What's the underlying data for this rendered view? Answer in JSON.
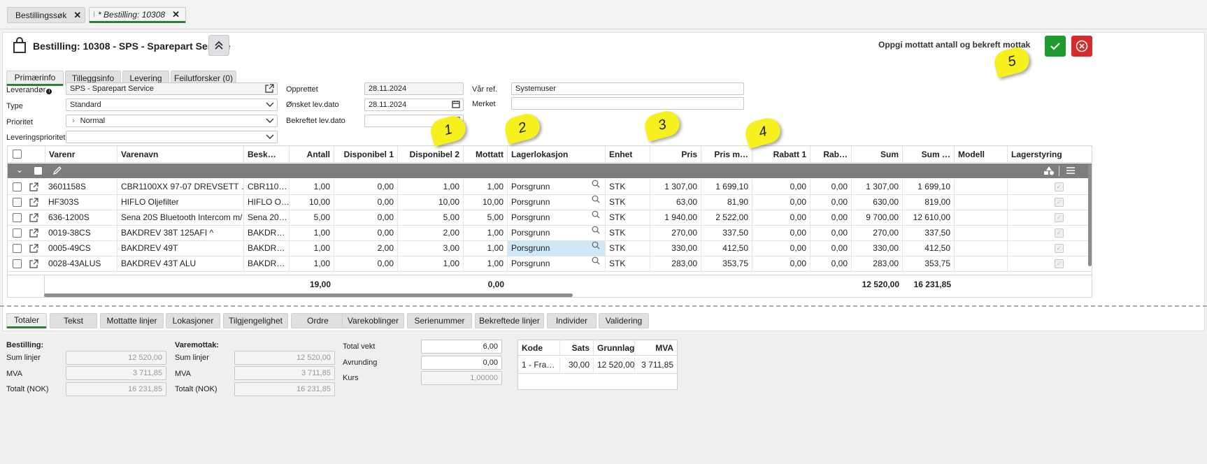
{
  "tabs": [
    {
      "label": "Bestillingssøk",
      "close": "✕"
    },
    {
      "label": "* Bestilling: 10308",
      "close": "✕"
    }
  ],
  "header": {
    "title": "Bestilling: 10308 - SPS - Sparepart Service",
    "instruction": "Oppgi mottatt antall og bekreft mottak"
  },
  "primary_tabs": [
    "Primærinfo",
    "Tilleggsinfo",
    "Levering",
    "Feilutforsker (0)"
  ],
  "form": {
    "leverandor": {
      "label": "Leverandør",
      "value": "SPS - Sparepart Service"
    },
    "type": {
      "label": "Type",
      "value": "Standard"
    },
    "prioritet": {
      "label": "Prioritet",
      "value": "Normal"
    },
    "leveringsprioritet": {
      "label": "Leveringsprioritet",
      "value": ""
    },
    "opprettet": {
      "label": "Opprettet",
      "value": "28.11.2024"
    },
    "onsket": {
      "label": "Ønsket lev.dato",
      "value": "28.11.2024"
    },
    "bekreftet": {
      "label": "Bekreftet lev.dato",
      "value": ""
    },
    "var_ref": {
      "label": "Vår ref.",
      "value": "Systemuser"
    },
    "merket": {
      "label": "Merket",
      "value": ""
    }
  },
  "callouts": [
    "1",
    "2",
    "3",
    "4",
    "5"
  ],
  "grid": {
    "columns": [
      "Varenr",
      "Varenavn",
      "Besk…",
      "Antall",
      "Disponibel 1",
      "Disponibel 2",
      "Mottatt",
      "Lagerlokasjon",
      "Enhet",
      "Pris",
      "Pris m…",
      "Rabatt 1",
      "Rab…",
      "Sum",
      "Sum …",
      "Modell",
      "Lagerstyring"
    ],
    "rows": [
      {
        "varenr": "3601158S",
        "varenavn": "CBR1100XX 97-07 DREVSETT …",
        "besk": "CBR110…",
        "antall": "1,00",
        "disp1": "0,00",
        "disp2": "1,00",
        "mottatt": "1,00",
        "lager": "Porsgrunn",
        "enhet": "STK",
        "pris": "1 307,00",
        "prism": "1 699,10",
        "rab1": "0,00",
        "rab": "0,00",
        "sum": "1 307,00",
        "summ": "1 699,10",
        "modell": ""
      },
      {
        "varenr": "HF303S",
        "varenavn": "HIFLO Oljefilter",
        "besk": "HIFLO O…",
        "antall": "10,00",
        "disp1": "0,00",
        "disp2": "10,00",
        "mottatt": "10,00",
        "lager": "Porsgrunn",
        "enhet": "STK",
        "pris": "63,00",
        "prism": "81,90",
        "rab1": "0,00",
        "rab": "0,00",
        "sum": "630,00",
        "summ": "819,00",
        "modell": ""
      },
      {
        "varenr": "636-1200S",
        "varenavn": "Sena 20S Bluetooth Intercom m/…",
        "besk": "Sena 20…",
        "antall": "5,00",
        "disp1": "0,00",
        "disp2": "5,00",
        "mottatt": "5,00",
        "lager": "Porsgrunn",
        "enhet": "STK",
        "pris": "1 940,00",
        "prism": "2 522,00",
        "rab1": "0,00",
        "rab": "0,00",
        "sum": "9 700,00",
        "summ": "12 610,00",
        "modell": ""
      },
      {
        "varenr": "0019-38CS",
        "varenavn": "BAKDREV 38T 125AFI ^",
        "besk": "BAKDR…",
        "antall": "1,00",
        "disp1": "0,00",
        "disp2": "2,00",
        "mottatt": "1,00",
        "lager": "Porsgrunn",
        "enhet": "STK",
        "pris": "270,00",
        "prism": "337,50",
        "rab1": "0,00",
        "rab": "0,00",
        "sum": "270,00",
        "summ": "337,50",
        "modell": ""
      },
      {
        "varenr": "0005-49CS",
        "varenavn": "BAKDREV 49T",
        "besk": "BAKDR…",
        "antall": "1,00",
        "disp1": "2,00",
        "disp2": "3,00",
        "mottatt": "1,00",
        "lager": "Porsgrunn",
        "enhet": "STK",
        "pris": "330,00",
        "prism": "412,50",
        "rab1": "0,00",
        "rab": "0,00",
        "sum": "330,00",
        "summ": "412,50",
        "modell": ""
      },
      {
        "varenr": "0028-43ALUS",
        "varenavn": "BAKDREV 43T ALU",
        "besk": "BAKDR…",
        "antall": "1,00",
        "disp1": "0,00",
        "disp2": "1,00",
        "mottatt": "1,00",
        "lager": "Porsgrunn",
        "enhet": "STK",
        "pris": "283,00",
        "prism": "353,75",
        "rab1": "0,00",
        "rab": "0,00",
        "sum": "283,00",
        "summ": "353,75",
        "modell": ""
      }
    ],
    "totals": {
      "antall": "19,00",
      "mottatt": "0,00",
      "sum": "12 520,00",
      "summ": "16 231,85"
    }
  },
  "bottom_tabs": [
    "Totaler",
    "Tekst",
    "Mottatte linjer",
    "Lokasjoner",
    "Tilgjengelighet",
    "Ordre",
    "Varekoblinger",
    "Serienummer",
    "Bekreftede linjer",
    "Individer",
    "Validering"
  ],
  "totals": {
    "bestilling": {
      "title": "Bestilling:",
      "sum_label": "Sum linjer",
      "sum": "12 520,00",
      "mva_label": "MVA",
      "mva": "3 711,85",
      "tot_label": "Totalt (NOK)",
      "tot": "16 231,85"
    },
    "varemottak": {
      "title": "Varemottak:",
      "sum_label": "Sum linjer",
      "sum": "12 520,00",
      "mva_label": "MVA",
      "mva": "3 711,85",
      "tot_label": "Totalt (NOK)",
      "tot": "16 231,85"
    },
    "vekt_label": "Total vekt",
    "vekt": "6,00",
    "avrunding_label": "Avrunding",
    "avrunding": "0,00",
    "kurs_label": "Kurs",
    "kurs": "1,00000"
  },
  "mva_table": {
    "headers": [
      "Kode",
      "Sats",
      "Grunnlag",
      "MVA"
    ],
    "row": [
      "1 - Fra…",
      "30,00",
      "12 520,00",
      "3 711,85"
    ]
  },
  "colors": {
    "accent": "#2f7d3b",
    "confirm": "#1f9a2e",
    "cancel": "#d62b2b",
    "callout": "#f5f01e"
  }
}
